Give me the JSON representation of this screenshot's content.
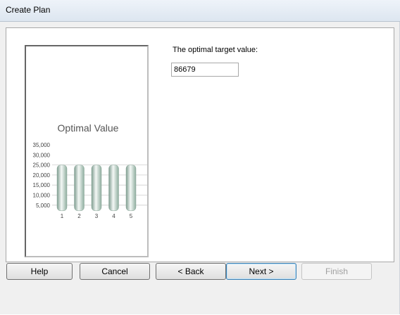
{
  "window": {
    "title": "Create Plan"
  },
  "content": {
    "prompt_label": "The optimal target value:",
    "target_value": "86679"
  },
  "illustration": {
    "title": "Optimal Value",
    "y_ticks": [
      "35,000",
      "30,000",
      "25,000",
      "20,000",
      "15,000",
      "10,000",
      "5,000"
    ],
    "x_ticks": [
      "1",
      "2",
      "3",
      "4",
      "5"
    ],
    "bar_value": 25000,
    "bar_color": "#b8cfc4"
  },
  "buttons": {
    "help": "Help",
    "cancel": "Cancel",
    "back": "< Back",
    "next": "Next >",
    "finish": "Finish"
  }
}
